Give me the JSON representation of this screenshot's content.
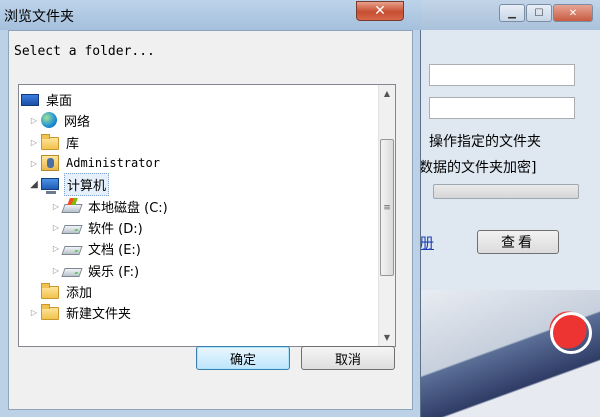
{
  "dialog": {
    "title": "浏览文件夹",
    "close_glyph": "✕",
    "prompt": "Select a folder...",
    "ok_label": "确定",
    "cancel_label": "取消"
  },
  "tree": {
    "items": [
      {
        "label": "桌面",
        "icon": "desktop-icon"
      },
      {
        "label": "网络",
        "icon": "network-icon"
      },
      {
        "label": "库",
        "icon": "library-icon"
      },
      {
        "label": "Administrator",
        "icon": "user-folder-icon"
      },
      {
        "label": "计算机",
        "icon": "computer-icon"
      },
      {
        "label": "本地磁盘 (C:)",
        "icon": "system-drive-icon"
      },
      {
        "label": "软件 (D:)",
        "icon": "drive-icon"
      },
      {
        "label": "文档 (E:)",
        "icon": "drive-icon"
      },
      {
        "label": "娱乐 (F:)",
        "icon": "drive-icon"
      },
      {
        "label": "添加",
        "icon": "folder-icon"
      },
      {
        "label": "新建文件夹",
        "icon": "folder-icon"
      }
    ]
  },
  "background_window": {
    "label_1": "操作指定的文件夹",
    "label_2": "数据的文件夹加密]",
    "link_text": "册",
    "view_button": "查看"
  },
  "colors": {
    "titlebar": "#bdd3ea",
    "close_button": "#c64d30",
    "default_button": "#3c7fb1"
  }
}
